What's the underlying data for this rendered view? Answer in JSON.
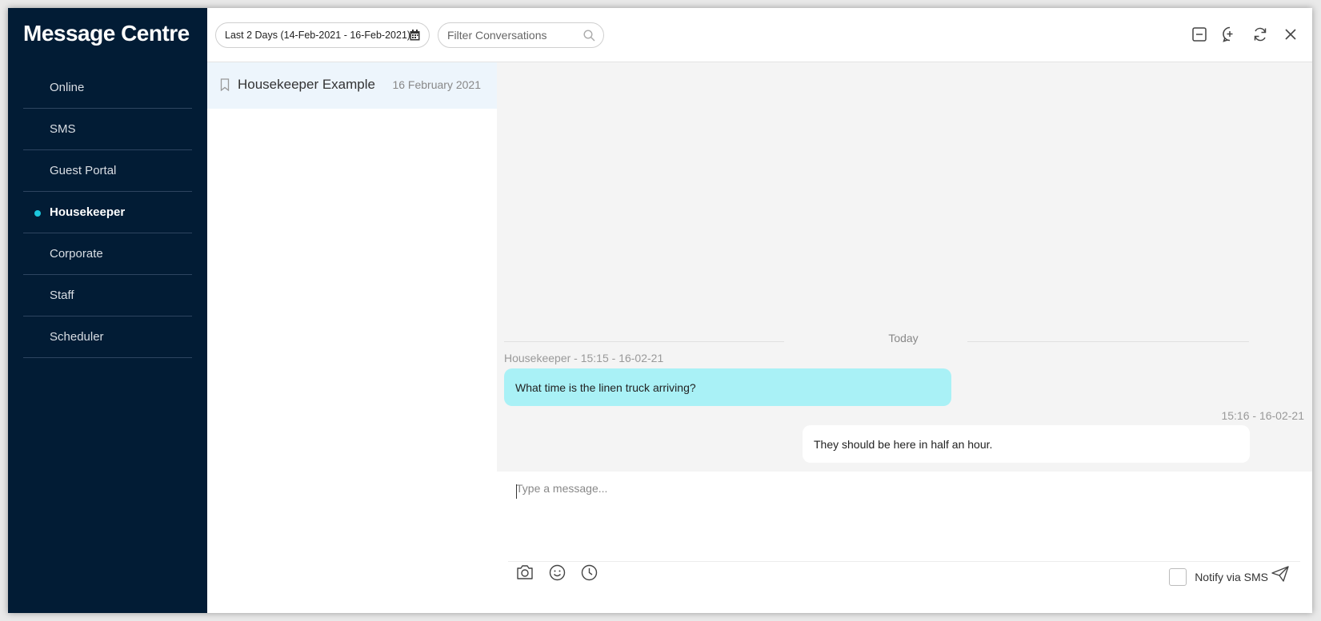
{
  "app": {
    "title": "Message Centre"
  },
  "sidebar": {
    "items": [
      {
        "label": "Online",
        "active": false
      },
      {
        "label": "SMS",
        "active": false
      },
      {
        "label": "Guest Portal",
        "active": false
      },
      {
        "label": "Housekeeper",
        "active": true
      },
      {
        "label": "Corporate",
        "active": false
      },
      {
        "label": "Staff",
        "active": false
      },
      {
        "label": "Scheduler",
        "active": false
      }
    ]
  },
  "toolbar": {
    "date_range": "Last 2 Days (14-Feb-2021 - 16-Feb-2021)",
    "filter_placeholder": "Filter Conversations",
    "icons": [
      "minimize-icon",
      "new-conversation-icon",
      "refresh-icon",
      "close-icon"
    ]
  },
  "conversations": [
    {
      "name": "Housekeeper Example",
      "date": "16 February 2021",
      "selected": true
    }
  ],
  "chat": {
    "day_separator": "Today",
    "messages": [
      {
        "direction": "incoming",
        "meta": "Housekeeper - 15:15 - 16-02-21",
        "text": "What time is the linen truck arriving?"
      },
      {
        "direction": "outgoing",
        "meta": "15:16 - 16-02-21",
        "text": "They should be here in half an hour."
      }
    ]
  },
  "composer": {
    "placeholder": "Type a message...",
    "notify_label": "Notify via SMS",
    "notify_checked": false,
    "tool_icons": [
      "camera-icon",
      "emoji-icon",
      "clock-icon"
    ]
  },
  "colors": {
    "sidebar_bg": "#021c35",
    "accent": "#1cc7dd",
    "incoming_bubble": "#a9f1f6",
    "chat_bg": "#f4f4f4"
  }
}
